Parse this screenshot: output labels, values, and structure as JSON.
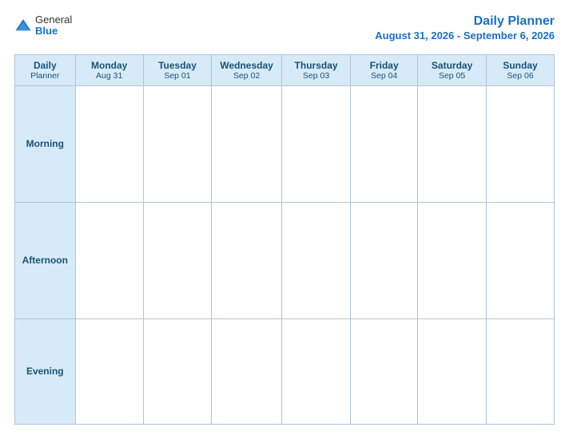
{
  "logo": {
    "general": "General",
    "blue": "Blue"
  },
  "header": {
    "title": "Daily Planner",
    "subtitle": "August 31, 2026 - September 6, 2026"
  },
  "columns": [
    {
      "day": "Daily Planner",
      "date": ""
    },
    {
      "day": "Monday",
      "date": "Aug 31"
    },
    {
      "day": "Tuesday",
      "date": "Sep 01"
    },
    {
      "day": "Wednesday",
      "date": "Sep 02"
    },
    {
      "day": "Thursday",
      "date": "Sep 03"
    },
    {
      "day": "Friday",
      "date": "Sep 04"
    },
    {
      "day": "Saturday",
      "date": "Sep 05"
    },
    {
      "day": "Sunday",
      "date": "Sep 06"
    }
  ],
  "rows": [
    {
      "label": "Morning"
    },
    {
      "label": "Afternoon"
    },
    {
      "label": "Evening"
    }
  ]
}
